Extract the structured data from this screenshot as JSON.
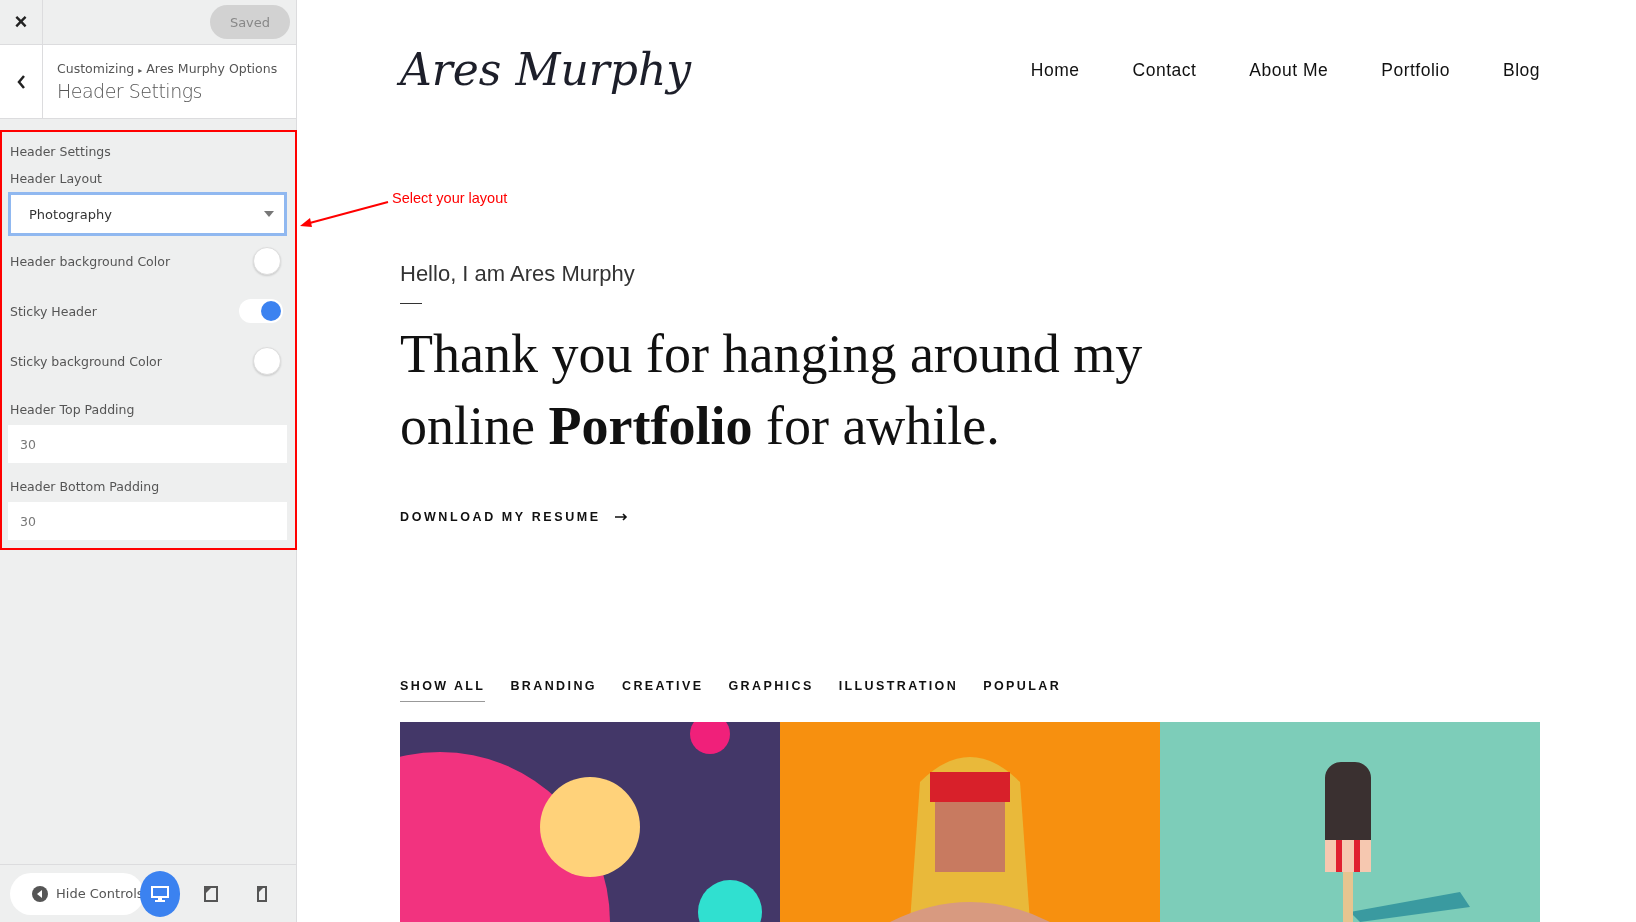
{
  "customizer": {
    "close": "×",
    "status": "Saved",
    "breadcrumb": "Customizing",
    "breadcrumb_separator": "▸",
    "breadcrumb_parent": "Ares Murphy Options",
    "title": "Header Settings",
    "section_title": "Header Settings",
    "controls": [
      {
        "kind": "select",
        "label": "Header Layout",
        "value": "Photography",
        "focused": true
      },
      {
        "kind": "color",
        "label": "Header background Color"
      },
      {
        "kind": "toggle",
        "label": "Sticky Header",
        "on": true
      },
      {
        "kind": "color",
        "label": "Sticky background Color"
      },
      {
        "kind": "number",
        "label": "Header Top Padding",
        "value": "30"
      },
      {
        "kind": "number",
        "label": "Header Bottom Padding",
        "value": "30"
      }
    ],
    "hide_controls": "Hide Controls",
    "devices": [
      {
        "kind": "desktop",
        "selected": true
      },
      {
        "kind": "tablet",
        "selected": false
      },
      {
        "kind": "mobile",
        "selected": false
      }
    ]
  },
  "annotation": {
    "text": "Select your layout"
  },
  "site": {
    "logo": "Ares Murphy",
    "nav": [
      "Home",
      "Contact",
      "About Me",
      "Portfolio",
      "Blog"
    ],
    "greeting": "Hello, I am Ares Murphy",
    "headline": "Thank you for hanging around my online **Portfolio** for awhile.",
    "cta": "DOWNLOAD MY RESUME",
    "filters": [
      {
        "label": "SHOW ALL",
        "selected": true
      },
      {
        "label": "BRANDING",
        "selected": false
      },
      {
        "label": "CREATIVE",
        "selected": false
      },
      {
        "label": "GRAPHICS",
        "selected": false
      },
      {
        "label": "ILLUSTRATION",
        "selected": false
      },
      {
        "label": "POPULAR",
        "selected": false
      }
    ],
    "portfolio": [
      {
        "kind": "space"
      },
      {
        "kind": "wrestler"
      },
      {
        "kind": "popsicle"
      }
    ]
  }
}
